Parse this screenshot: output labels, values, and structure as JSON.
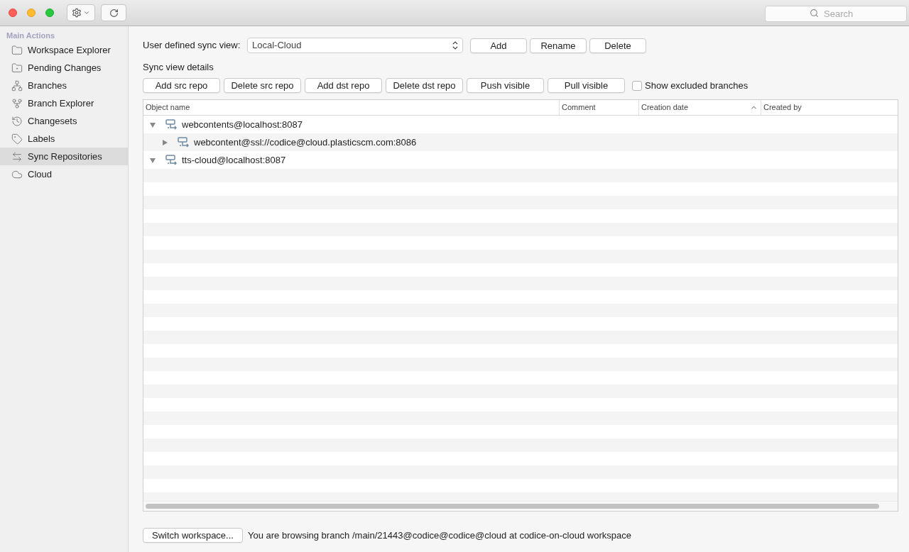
{
  "toolbar": {
    "search": {
      "placeholder": "Search"
    }
  },
  "sidebar": {
    "heading": "Main Actions",
    "items": [
      {
        "label": "Workspace Explorer",
        "selected": false
      },
      {
        "label": "Pending Changes",
        "selected": false
      },
      {
        "label": "Branches",
        "selected": false
      },
      {
        "label": "Branch Explorer",
        "selected": false
      },
      {
        "label": "Changesets",
        "selected": false
      },
      {
        "label": "Labels",
        "selected": false
      },
      {
        "label": "Sync Repositories",
        "selected": true
      },
      {
        "label": "Cloud",
        "selected": false
      }
    ]
  },
  "sync_view": {
    "label": "User defined sync view:",
    "value": "Local-Cloud",
    "buttons": [
      "Add",
      "Rename",
      "Delete"
    ]
  },
  "details": {
    "heading": "Sync view details",
    "buttons": [
      "Add src repo",
      "Delete src repo",
      "Add dst repo",
      "Delete dst repo",
      "Push visible",
      "Pull visible"
    ],
    "show_excluded": {
      "label": "Show excluded branches",
      "checked": false
    }
  },
  "table": {
    "columns": [
      {
        "label": "Object name",
        "sorted": false
      },
      {
        "label": "Comment",
        "sorted": false
      },
      {
        "label": "Creation date",
        "sorted": true
      },
      {
        "label": "Created by",
        "sorted": false
      }
    ],
    "rows": [
      {
        "name": "webcontents@localhost:8087",
        "expanded": true,
        "children": [
          {
            "name": "webcontent@ssl://codice@cloud.plasticscm.com:8086",
            "expanded": false
          }
        ]
      },
      {
        "name": "tts-cloud@localhost:8087",
        "expanded": true
      }
    ]
  },
  "footer": {
    "button": "Switch workspace...",
    "status": "You are browsing branch /main/21443@codice@codice@cloud at codice-on-cloud workspace"
  }
}
